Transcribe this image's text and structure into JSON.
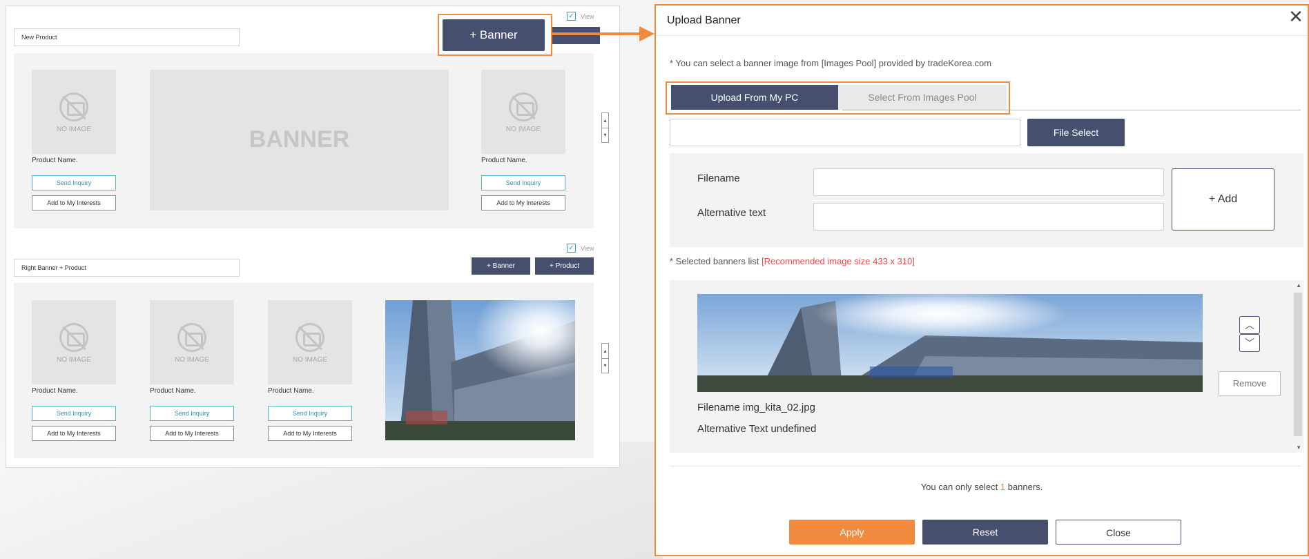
{
  "left_panel": {
    "section1": {
      "name_value": "New Product",
      "view_label": "View",
      "banner_button": "+ Banner",
      "banner_placeholder": "BANNER",
      "products": [
        {
          "no_image": "NO IMAGE",
          "name": "Product Name.",
          "inquiry": "Send Inquiry",
          "interests": "Add to My Interests"
        },
        {
          "no_image": "NO IMAGE",
          "name": "Product Name.",
          "inquiry": "Send Inquiry",
          "interests": "Add to My Interests"
        }
      ],
      "updown": {
        "up": "▴",
        "down": "▾"
      }
    },
    "section2": {
      "name_value": "Right Banner + Product",
      "view_label": "View",
      "banner_button": "+ Banner",
      "product_button": "+ Product",
      "products": [
        {
          "no_image": "NO IMAGE",
          "name": "Product Name.",
          "inquiry": "Send Inquiry",
          "interests": "Add to My Interests"
        },
        {
          "no_image": "NO IMAGE",
          "name": "Product Name.",
          "inquiry": "Send Inquiry",
          "interests": "Add to My Interests"
        },
        {
          "no_image": "NO IMAGE",
          "name": "Product Name.",
          "inquiry": "Send Inquiry",
          "interests": "Add to My Interests"
        }
      ],
      "updown": {
        "up": "▴",
        "down": "▾"
      }
    }
  },
  "modal": {
    "title": "Upload Banner",
    "close_icon": "✕",
    "note": "* You can select a banner image from [Images Pool] provided by tradeKorea.com",
    "tabs": [
      {
        "label": "Upload From My PC",
        "active": true
      },
      {
        "label": "Select From Images Pool",
        "active": false
      }
    ],
    "file_select": "File Select",
    "filename_label": "Filename",
    "alt_label": "Alternative text",
    "add_button": "+ Add",
    "list_note": "* Selected banners list",
    "list_note_warning": "[Recommended image size 433 x 310]",
    "banner_item": {
      "filename_text": "Filename img_kita_02.jpg",
      "alt_text": "Alternative Text undefined",
      "remove": "Remove",
      "up": "︿",
      "down": "﹀"
    },
    "limit_prefix": "You can only select",
    "limit_count": "1",
    "limit_suffix": "banners.",
    "footer": {
      "apply": "Apply",
      "reset": "Reset",
      "close": "Close"
    }
  },
  "colors": {
    "navy": "#46506e",
    "orange": "#f08a3e",
    "teal": "#2b96b0",
    "warning_red": "#e84b4b"
  }
}
